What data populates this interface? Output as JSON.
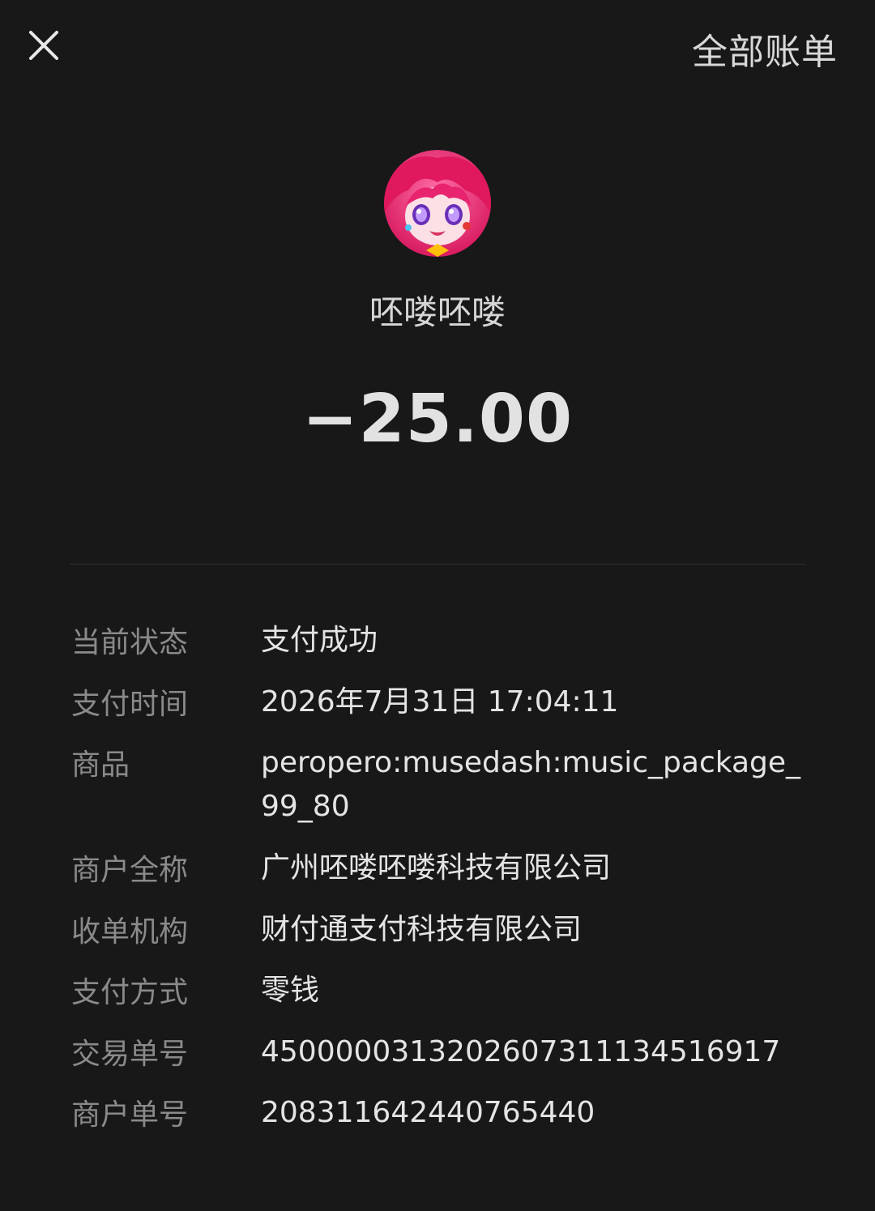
{
  "header": {
    "close_icon": "close-icon",
    "all_bills_label": "全部账单"
  },
  "merchant": {
    "avatar": "anime-girl-avatar",
    "name": "呸喽呸喽"
  },
  "amount": "−25.00",
  "details": [
    {
      "label": "当前状态",
      "value": "支付成功"
    },
    {
      "label": "支付时间",
      "value": "2026年7月31日 17:04:11"
    },
    {
      "label": "商品",
      "value": "peropero:musedash:music_package_99_80"
    },
    {
      "label": "商户全称",
      "value": "广州呸喽呸喽科技有限公司"
    },
    {
      "label": "收单机构",
      "value": "财付通支付科技有限公司"
    },
    {
      "label": "支付方式",
      "value": "零钱"
    },
    {
      "label": "交易单号",
      "value": "4500000313202607311134516917"
    },
    {
      "label": "商户单号",
      "value": "2083116424407654​40"
    }
  ],
  "colors": {
    "background": "#181818",
    "avatar_primary": "#e8246e",
    "avatar_secondary": "#b86ce6"
  }
}
